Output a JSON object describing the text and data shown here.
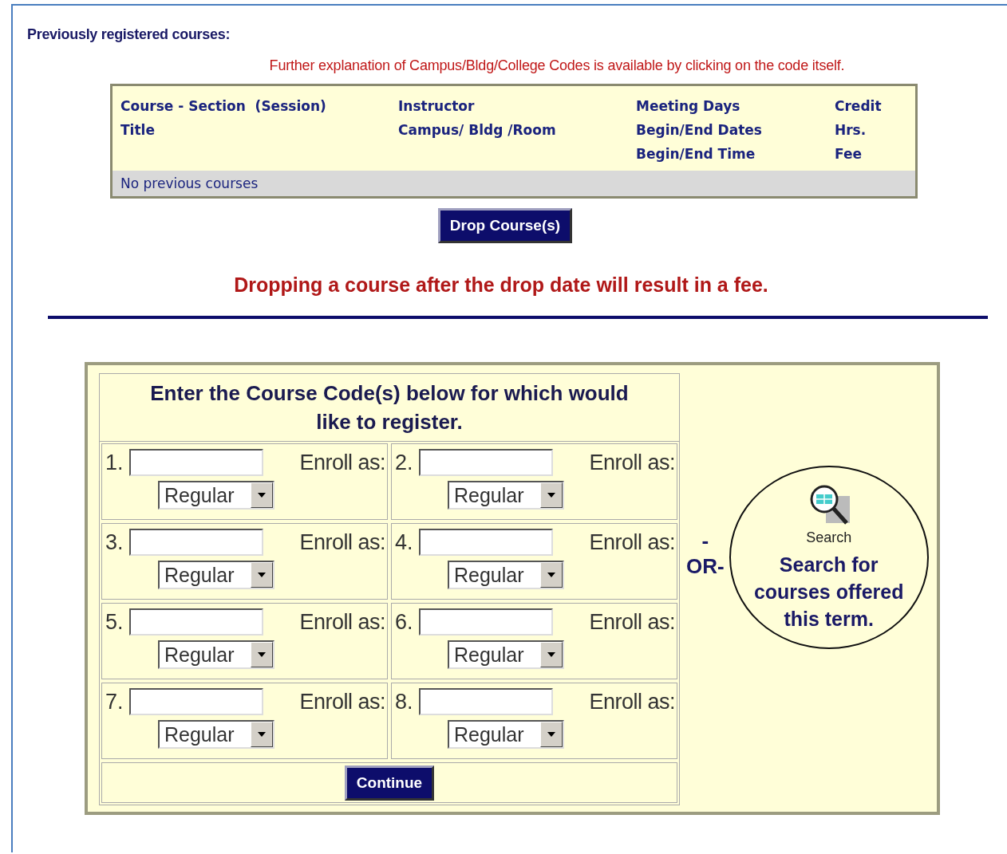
{
  "section_title": "Previously registered courses:",
  "notice": "Further explanation of Campus/Bldg/College Codes is available by clicking on the code itself.",
  "previous_table": {
    "columns": [
      [
        "Course - Section  (Session)",
        "Title"
      ],
      [
        "Instructor",
        "Campus/ Bldg /Room"
      ],
      [
        "Meeting Days",
        "Begin/End Dates",
        "Begin/End Time"
      ],
      [
        "Credit",
        "Hrs.",
        "Fee"
      ]
    ],
    "empty_message": "No previous courses"
  },
  "drop_button": "Drop Course(s)",
  "warning": "Dropping a course after the drop date will result in a fee.",
  "register": {
    "heading": "Enter the Course Code(s) below for which would like to register.",
    "slots": [
      {
        "number": "1.",
        "label": "Enroll as:",
        "select": "Regular"
      },
      {
        "number": "2.",
        "label": "Enroll as:",
        "select": "Regular"
      },
      {
        "number": "3.",
        "label": "Enroll as:",
        "select": "Regular"
      },
      {
        "number": "4.",
        "label": "Enroll as:",
        "select": "Regular"
      },
      {
        "number": "5.",
        "label": "Enroll as:",
        "select": "Regular"
      },
      {
        "number": "6.",
        "label": "Enroll as:",
        "select": "Regular"
      },
      {
        "number": "7.",
        "label": "Enroll as:",
        "select": "Regular"
      },
      {
        "number": "8.",
        "label": "Enroll as:",
        "select": "Regular"
      }
    ],
    "continue_button": "Continue"
  },
  "search": {
    "separator_dash": "-",
    "separator_or": "OR-",
    "icon_label": "Search",
    "link": "Search for courses offered this term."
  }
}
